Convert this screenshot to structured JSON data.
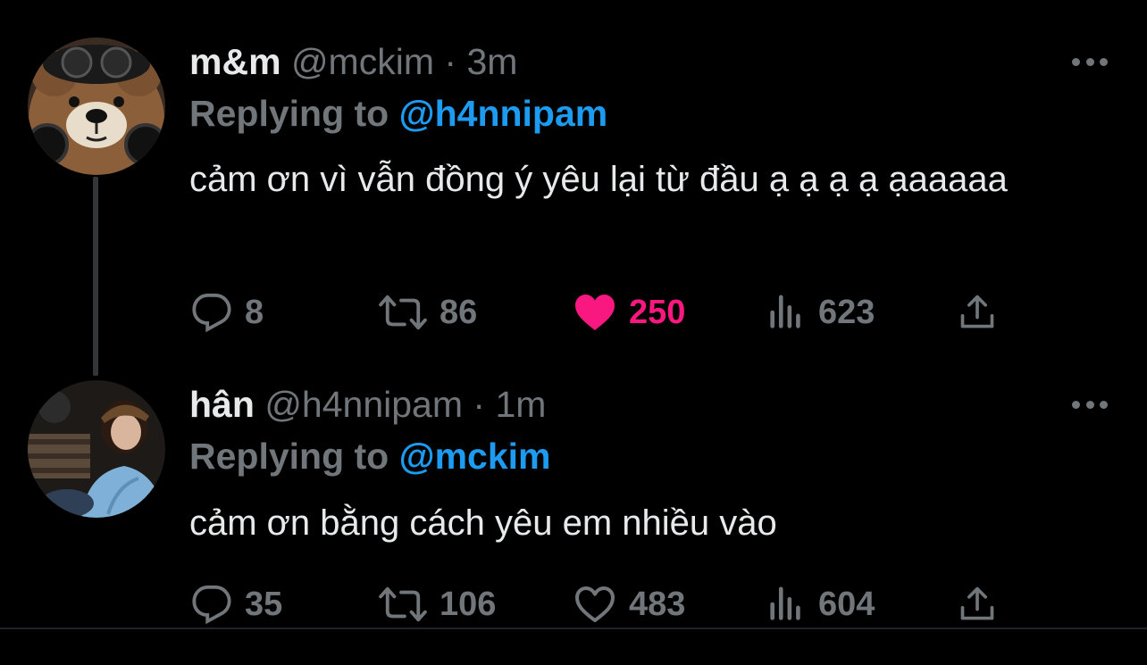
{
  "tweets": [
    {
      "name": "m&m",
      "handle": "@mckim",
      "separator": "·",
      "time": "3m",
      "replying_prefix": "Replying to",
      "replying_to": "@h4nnipam",
      "text": "cảm ơn vì vẫn đồng ý yêu lại từ đầu ạ ạ ạ ạ ạaaaaa",
      "counts": {
        "replies": "8",
        "retweets": "86",
        "likes": "250",
        "views": "623"
      },
      "liked": true,
      "avatar_icon": "teddy-bear-avatar"
    },
    {
      "name": "hân",
      "handle": "@h4nnipam",
      "separator": "·",
      "time": "1m",
      "replying_prefix": "Replying to",
      "replying_to": "@mckim",
      "text": "cảm ơn bằng cách yêu em nhiều vào",
      "counts": {
        "replies": "35",
        "retweets": "106",
        "likes": "483",
        "views": "604"
      },
      "liked": false,
      "avatar_icon": "user-photo-avatar"
    }
  ],
  "icons": {
    "reply": "reply-icon",
    "retweet": "retweet-icon",
    "like": "heart-icon",
    "views": "views-icon",
    "share": "share-icon",
    "more": "more-icon"
  },
  "colors": {
    "background": "#000000",
    "text_primary": "#e7e9ea",
    "text_secondary": "#71767b",
    "accent": "#1d9bf0",
    "like_active": "#f91880"
  }
}
